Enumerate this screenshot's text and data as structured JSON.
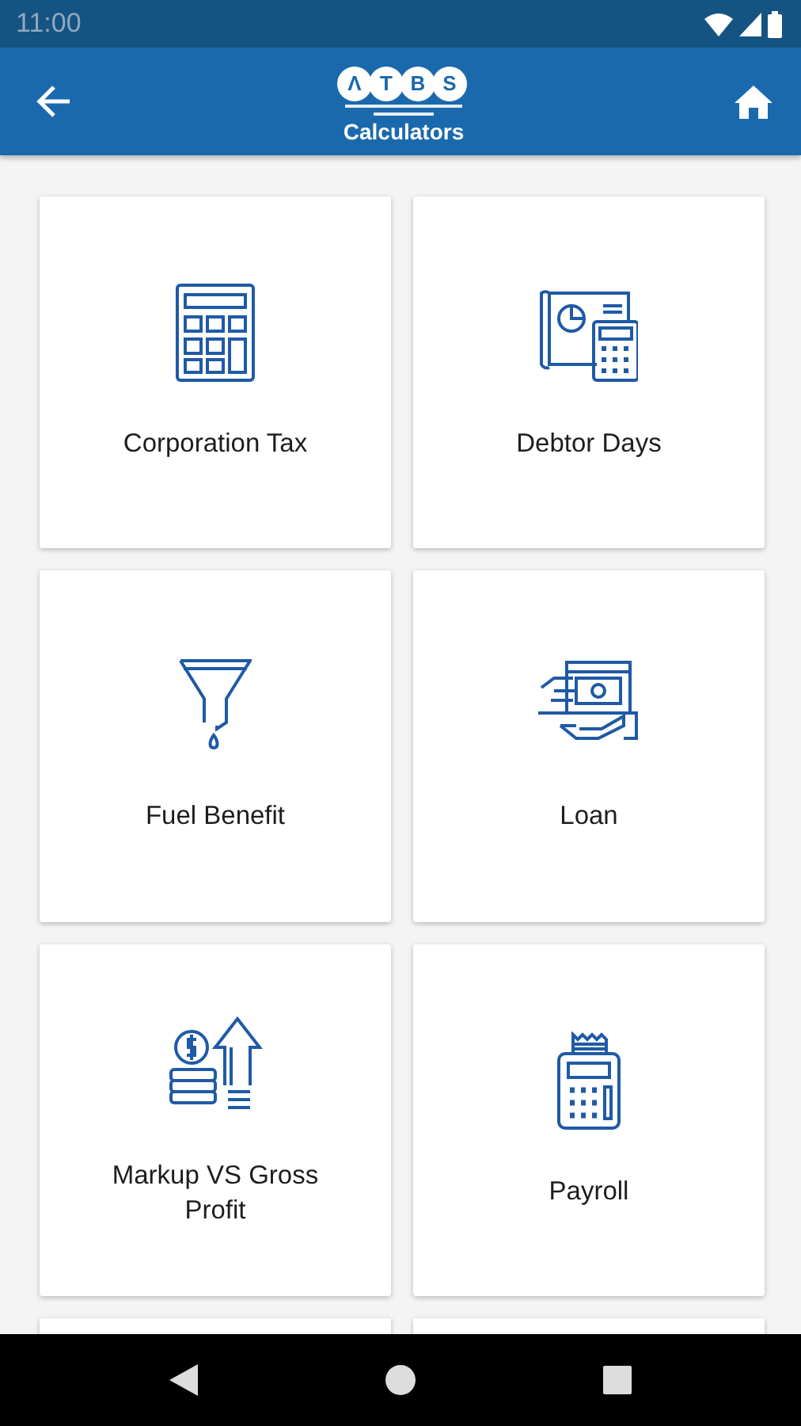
{
  "status_bar": {
    "time": "11:00"
  },
  "app_bar": {
    "logo_letters": [
      "Λ",
      "T",
      "B",
      "S"
    ],
    "title": "Calculators"
  },
  "calculators": [
    {
      "label": "Corporation Tax"
    },
    {
      "label": "Debtor Days"
    },
    {
      "label": "Fuel Benefit"
    },
    {
      "label": "Loan"
    },
    {
      "label": "Markup VS Gross Profit"
    },
    {
      "label": "Payroll"
    }
  ]
}
